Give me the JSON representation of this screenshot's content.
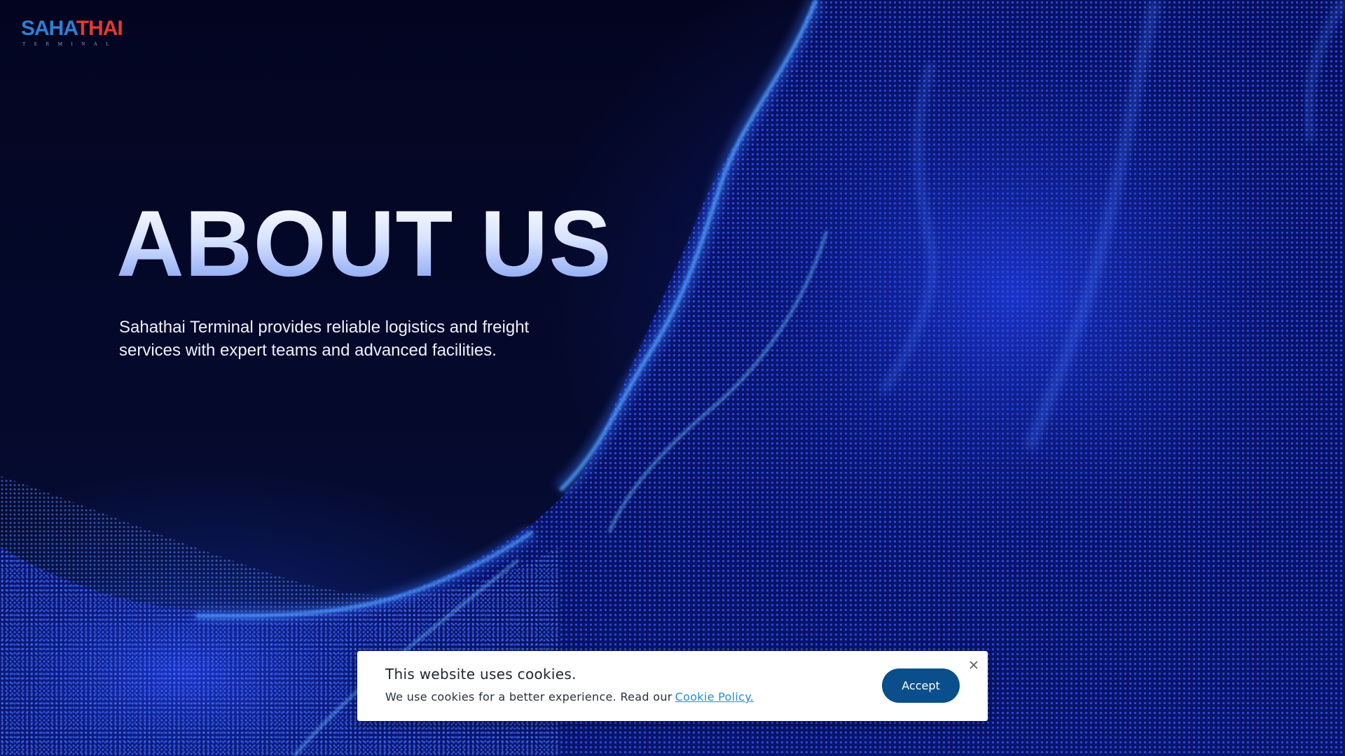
{
  "logo": {
    "word_left": "SAHA",
    "word_right": "THAI",
    "subtitle": "TERMINAL"
  },
  "hero": {
    "title": "ABOUT US",
    "description": "Sahathai Terminal provides reliable logistics and freight services with expert teams and advanced facilities."
  },
  "cookie_banner": {
    "title": "This website uses cookies.",
    "text": "We use cookies for a better experience. Read our",
    "link_label": "Cookie Policy.",
    "accept_label": "Accept",
    "close_icon": "close-icon"
  },
  "colors": {
    "background": "#03061f",
    "wave_primary": "#2b4fff",
    "wave_highlight": "#4fb0ff",
    "logo_blue": "#2f7fd6",
    "logo_red": "#e53a2e",
    "accept_button": "#0a4f8c",
    "link": "#1e8fd0"
  }
}
